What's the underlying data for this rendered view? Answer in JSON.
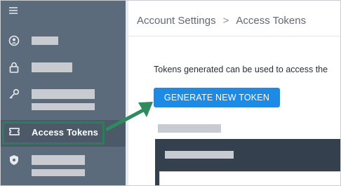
{
  "breadcrumb": {
    "parent": "Account Settings",
    "separator": ">",
    "current": "Access Tokens"
  },
  "sidebar": {
    "menu_icon": "hamburger-icon",
    "items": [
      {
        "icon": "user-circle-icon",
        "label": "",
        "redacted": true
      },
      {
        "icon": "lock-icon",
        "label": "",
        "redacted": true
      },
      {
        "icon": "key-icon",
        "label": "",
        "redacted": true
      },
      {
        "icon": "token-icon",
        "label": "Access Tokens",
        "active": true
      },
      {
        "icon": "shield-icon",
        "label": "",
        "redacted": true
      }
    ]
  },
  "main": {
    "description": "Tokens generated can be used to access the",
    "generate_button": "GENERATE NEW TOKEN"
  },
  "colors": {
    "sidebar_bg": "#5c6b7b",
    "active_outline": "#2e7d5a",
    "primary_button": "#1d8ae6",
    "card_header": "#34404d",
    "arrow": "#2e8b5f"
  }
}
